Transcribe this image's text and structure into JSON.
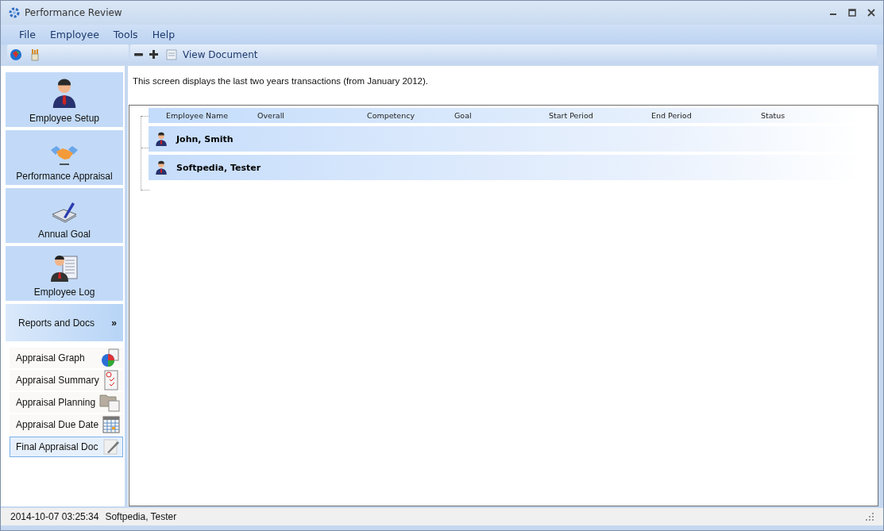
{
  "window": {
    "title": "Performance Review"
  },
  "menu": [
    "File",
    "Employee",
    "Tools",
    "Help"
  ],
  "toolbar": {
    "view_document": "View Document"
  },
  "nav_buttons": [
    {
      "label": "Employee Setup",
      "kind": "person"
    },
    {
      "label": "Performance Appraisal",
      "kind": "handshake"
    },
    {
      "label": "Annual Goal",
      "kind": "book"
    },
    {
      "label": "Employee Log",
      "kind": "log"
    }
  ],
  "reports_section": {
    "label": "Reports and Docs",
    "chevron": "»"
  },
  "reports": [
    {
      "label": "Appraisal Graph",
      "kind": "graph",
      "selected": false
    },
    {
      "label": "Appraisal Summary",
      "kind": "summary",
      "selected": false
    },
    {
      "label": "Appraisal Planning",
      "kind": "planning",
      "selected": false
    },
    {
      "label": "Appraisal Due Date",
      "kind": "calendar",
      "selected": false
    },
    {
      "label": "Final Appraisal Doc",
      "kind": "doc",
      "selected": true
    }
  ],
  "content": {
    "description": "This screen displays the last two years transactions (from January 2012).",
    "table": {
      "columns": [
        "Employee Name",
        "Overall",
        "Competency",
        "Goal",
        "Start Period",
        "End Period",
        "Status"
      ],
      "rows": [
        {
          "name": "John, Smith"
        },
        {
          "name": "Softpedia, Tester"
        }
      ]
    }
  },
  "status_bar": {
    "timestamp": "2014-10-07 03:25:34",
    "user": "Softpedia, Tester"
  }
}
